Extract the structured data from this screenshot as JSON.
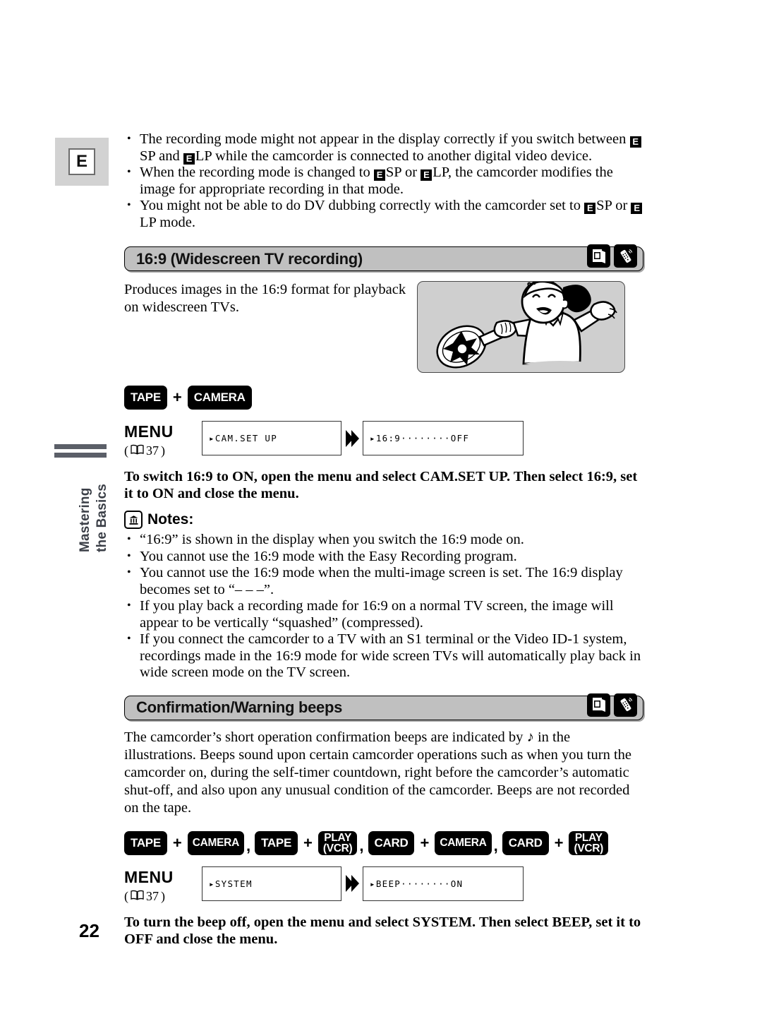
{
  "page": {
    "number": "22",
    "language_tab": "E",
    "side_tab_line1": "Mastering",
    "side_tab_line2": "the Basics"
  },
  "intro_bullets": [
    {
      "parts": [
        {
          "t": "text",
          "v": "The recording mode might not appear in the display correctly if you switch between "
        },
        {
          "t": "cassette",
          "v": "E"
        },
        {
          "t": "text",
          "v": "SP and "
        },
        {
          "t": "cassette",
          "v": "E"
        },
        {
          "t": "text",
          "v": "LP while the camcorder is connected to another digital video device."
        }
      ]
    },
    {
      "parts": [
        {
          "t": "text",
          "v": "When the recording mode is changed to "
        },
        {
          "t": "cassette",
          "v": "E"
        },
        {
          "t": "text",
          "v": "SP or "
        },
        {
          "t": "cassette",
          "v": "E"
        },
        {
          "t": "text",
          "v": "LP, the camcorder modifies the image for appropriate recording in that mode."
        }
      ]
    },
    {
      "parts": [
        {
          "t": "text",
          "v": "You might not be able to do DV dubbing correctly with the camcorder set to "
        },
        {
          "t": "cassette",
          "v": "E"
        },
        {
          "t": "text",
          "v": "SP or "
        },
        {
          "t": "cassette",
          "v": "E"
        },
        {
          "t": "text",
          "v": "LP mode."
        }
      ]
    }
  ],
  "section_widescreen": {
    "title": "16:9 (Widescreen TV recording)",
    "header_icons": [
      "card-icon",
      "remote-icon"
    ],
    "intro_text": "Produces images in the 16:9 format for playback on widescreen TVs.",
    "illustration_alt": "girl-with-tennis-racket-illustration",
    "mode_badges": [
      {
        "type": "badge",
        "label": "TAPE"
      },
      {
        "type": "plus",
        "label": "+"
      },
      {
        "type": "badge",
        "label": "CAMERA"
      }
    ],
    "menu": {
      "label": "MENU",
      "reference_open": "(",
      "reference_page": "37",
      "reference_close": ")",
      "step1": "▸CAM.SET UP",
      "step2": "▸16:9········OFF"
    },
    "instruction": "To switch 16:9 to ON, open the menu and select CAM.SET UP. Then select 16:9, set it to ON and close the menu.",
    "notes_label": "Notes:",
    "notes": [
      "“16:9” is shown in the display when you switch the 16:9 mode on.",
      "You cannot use the 16:9 mode with the Easy Recording program.",
      "You cannot use the 16:9 mode when the multi-image screen is set. The 16:9 display becomes set to “– – –”.",
      "If you play back a recording made for 16:9 on a normal TV screen, the image will appear to be vertically “squashed” (compressed).",
      "If you connect the camcorder to a TV with an S1 terminal or the Video ID-1 system, recordings made in the 16:9 mode for wide screen TVs will automatically play back in wide screen mode on the TV screen."
    ]
  },
  "section_beeps": {
    "title": "Confirmation/Warning beeps",
    "header_icons": [
      "card-icon",
      "remote-icon"
    ],
    "paragraph_a": "The camcorder’s short operation confirmation beeps are indicated by ",
    "paragraph_note_glyph": "♪",
    "paragraph_b": " in the illustrations. Beeps sound upon certain camcorder operations such as when you turn the camcorder on, during the self-timer countdown, right before the camcorder’s automatic shut-off, and also upon any unusual condition of the camcorder. Beeps are not recorded on the tape.",
    "mode_badges": [
      {
        "type": "badge",
        "label": "TAPE"
      },
      {
        "type": "plus",
        "label": "+"
      },
      {
        "type": "badge",
        "label": "CAMERA"
      },
      {
        "type": "comma",
        "label": ","
      },
      {
        "type": "badge",
        "label": "TAPE"
      },
      {
        "type": "plus",
        "label": "+"
      },
      {
        "type": "badge2",
        "line1": "PLAY",
        "line2": "(VCR)"
      },
      {
        "type": "comma",
        "label": ","
      },
      {
        "type": "badge",
        "label": "CARD"
      },
      {
        "type": "plus",
        "label": "+"
      },
      {
        "type": "badge",
        "label": "CAMERA"
      },
      {
        "type": "comma",
        "label": ","
      },
      {
        "type": "badge",
        "label": "CARD"
      },
      {
        "type": "plus",
        "label": "+"
      },
      {
        "type": "badge2",
        "line1": "PLAY",
        "line2": "(VCR)"
      }
    ],
    "menu": {
      "label": "MENU",
      "reference_open": "(",
      "reference_page": "37",
      "reference_close": ")",
      "step1": "▸SYSTEM",
      "step2": "▸BEEP········ON"
    },
    "instruction": "To turn the beep off, open the menu and select SYSTEM. Then select BEEP, set it to OFF and close the menu."
  },
  "colors": {
    "header_bar": "#c0c0c0",
    "lang_tab_bg": "#d2d2d2",
    "side_rule": "#5b5f68",
    "illustration_bg": "#cfcfcf",
    "badge_bg": "#000000"
  }
}
